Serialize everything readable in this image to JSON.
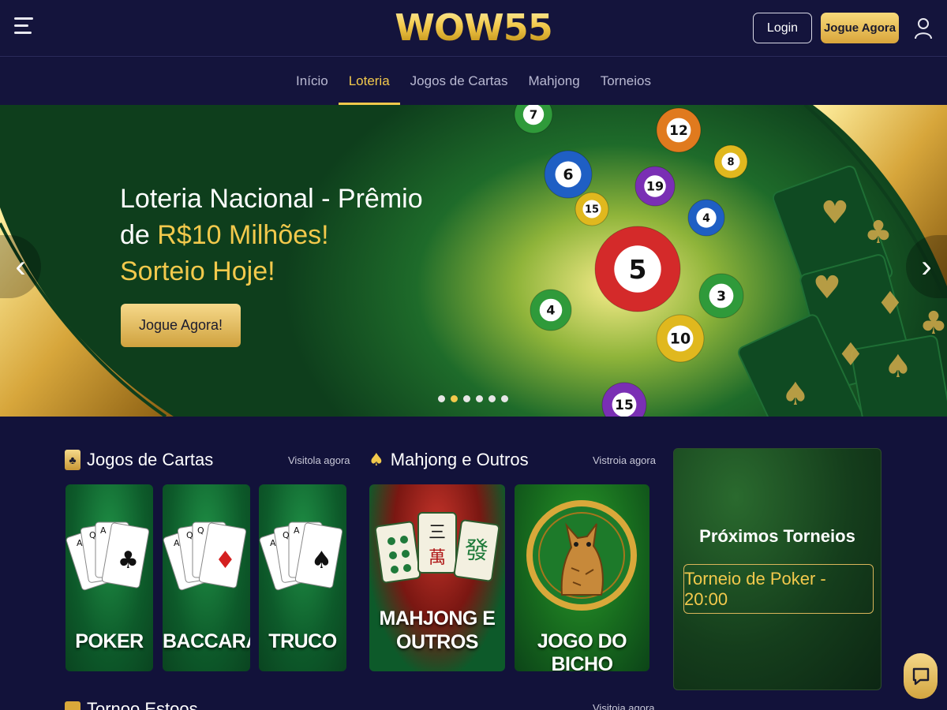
{
  "header": {
    "logo": "WOW55",
    "login_label": "Login",
    "play_label": "Jogue Agora"
  },
  "nav": {
    "items": [
      {
        "label": "Início",
        "active": false
      },
      {
        "label": "Loteria",
        "active": true
      },
      {
        "label": "Jogos de Cartas",
        "active": false
      },
      {
        "label": "Mahjong",
        "active": false
      },
      {
        "label": "Torneios",
        "active": false
      }
    ]
  },
  "hero": {
    "line1": "Loteria Nacional - Prêmio",
    "line2_prefix": "de ",
    "line2_highlight": "R$10 Milhões!",
    "line3": "Sorteio Hoje!",
    "cta_label": "Jogue Agora!",
    "slide_count": 6,
    "active_slide": 2,
    "balls": [
      "7",
      "12",
      "6",
      "8",
      "19",
      "15",
      "4",
      "5",
      "3",
      "4",
      "10",
      "15"
    ]
  },
  "cards_section": {
    "title": "Jogos de Cartas",
    "link": "Visitola agora",
    "cards": [
      {
        "label": "POKER",
        "suit": "♣"
      },
      {
        "label": "BACCARAT",
        "suit": "♦"
      },
      {
        "label": "TRUCO",
        "suit": "♠"
      }
    ]
  },
  "mahjong_section": {
    "title": "Mahjong e Outros",
    "link": "Vistroia agora",
    "cards": [
      {
        "label_line1": "MAHJONG E",
        "label_line2": "OUTROS"
      },
      {
        "label": "JOGO DO BICHO"
      }
    ],
    "tile_chars": [
      "三",
      "萬",
      "發"
    ]
  },
  "tournaments": {
    "title": "Próximos Torneios",
    "item": "Torneio de Poker - 20:00"
  },
  "partial_section": {
    "title": "Tornoo Estoos",
    "link": "Visitoia agora"
  },
  "colors": {
    "gold": "#f2c94c",
    "navy": "#12123a",
    "green": "#0d5a2a"
  }
}
